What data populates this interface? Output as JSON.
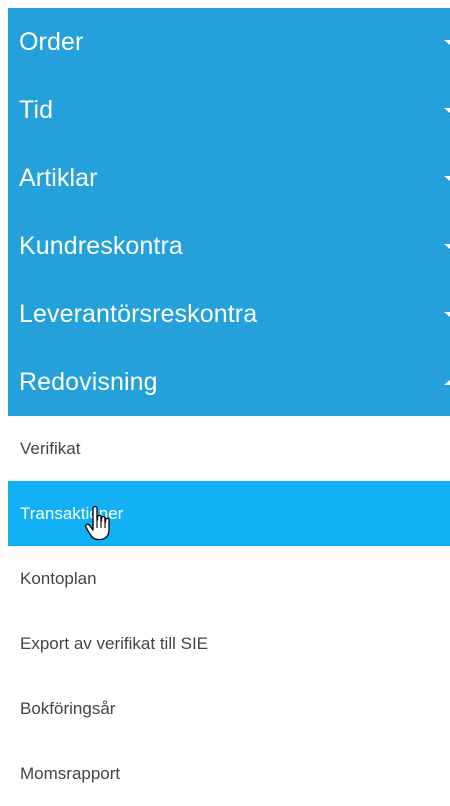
{
  "sections": [
    {
      "label": "Order",
      "expanded": false
    },
    {
      "label": "Tid",
      "expanded": false
    },
    {
      "label": "Artiklar",
      "expanded": false
    },
    {
      "label": "Kundreskontra",
      "expanded": false
    },
    {
      "label": "Leverantörsreskontra",
      "expanded": false
    },
    {
      "label": "Redovisning",
      "expanded": true
    }
  ],
  "submenu": {
    "items": [
      {
        "label": "Verifikat",
        "active": false
      },
      {
        "label": "Transaktioner",
        "active": true
      },
      {
        "label": "Kontoplan",
        "active": false
      },
      {
        "label": "Export av verifikat till SIE",
        "active": false
      },
      {
        "label": "Bokföringsår",
        "active": false
      },
      {
        "label": "Momsrapport",
        "active": false
      }
    ]
  },
  "colors": {
    "section_bg": "#24a0da",
    "active_item_bg": "#12b1f5",
    "item_text": "#444444"
  },
  "icons": {
    "collapsed": "chevron-down-icon",
    "expanded": "chevron-up-icon",
    "cursor": "hand-pointer-icon"
  }
}
